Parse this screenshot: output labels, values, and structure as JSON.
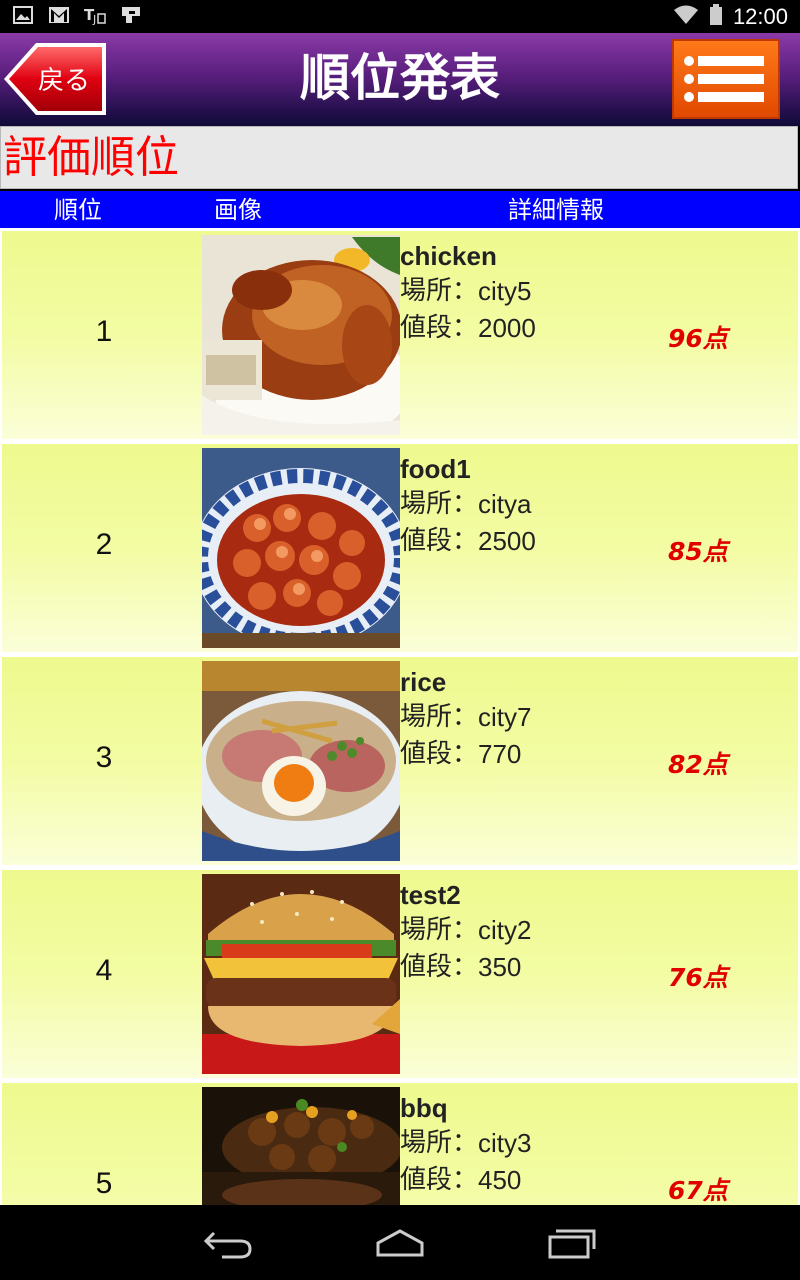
{
  "status_bar": {
    "time": "12:00"
  },
  "header": {
    "back_label": "戻る",
    "title": "順位発表"
  },
  "section": {
    "title": "評価順位"
  },
  "columns": {
    "rank": "順位",
    "image": "画像",
    "details": "詳細情報"
  },
  "labels": {
    "location": "場所：",
    "price": "値段："
  },
  "items": [
    {
      "rank": "1",
      "name": "chicken",
      "location": "city5",
      "price": "2000",
      "score": "96点",
      "image": "roast-chicken"
    },
    {
      "rank": "2",
      "name": "food1",
      "location": "citya",
      "price": "2500",
      "score": "85点",
      "image": "shrimp-chili"
    },
    {
      "rank": "3",
      "name": "rice",
      "location": "city7",
      "price": "770",
      "score": "82点",
      "image": "ramen-bowl"
    },
    {
      "rank": "4",
      "name": "test2",
      "location": "city2",
      "price": "350",
      "score": "76点",
      "image": "hamburger"
    },
    {
      "rank": "5",
      "name": "bbq",
      "location": "city3",
      "price": "450",
      "score": "67点",
      "image": "bbq-skewers"
    }
  ],
  "colors": {
    "accent": "#0000ff",
    "score": "#e00000",
    "section_title": "#ff0000",
    "row_bg": "#f3fca3"
  }
}
